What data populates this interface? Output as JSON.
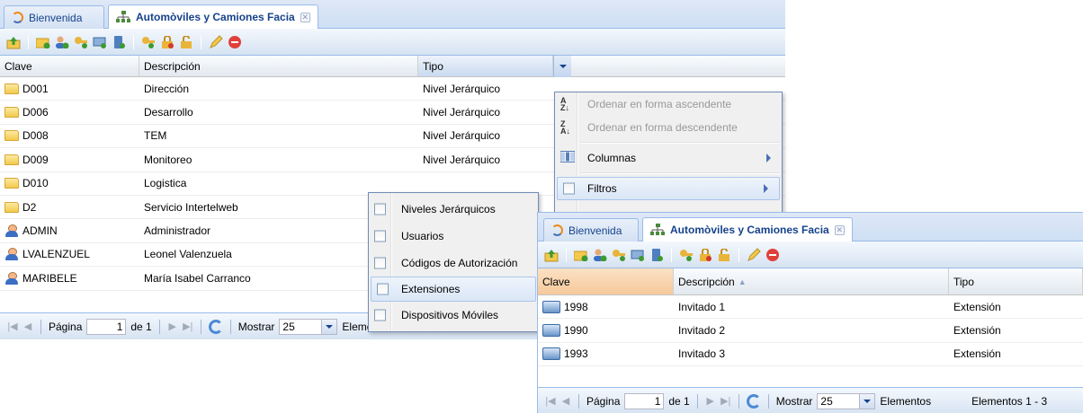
{
  "colors": {
    "header_blue": "#15428b",
    "panel_border": "#99bbe8",
    "sorted_header": "#f6c99c"
  },
  "main": {
    "tabs": [
      {
        "label": "Bienvenida",
        "icon": "swirl-icon"
      },
      {
        "label": "Automòviles y Camiones Facia",
        "icon": "org-chart-icon",
        "closable": true
      }
    ],
    "columns": [
      "Clave",
      "Descripción",
      "Tipo"
    ],
    "rows": [
      {
        "icon": "folder-icon",
        "clave": "D001",
        "descripcion": "Dirección",
        "tipo": "Nivel Jerárquico"
      },
      {
        "icon": "folder-icon",
        "clave": "D006",
        "descripcion": "Desarrollo",
        "tipo": "Nivel Jerárquico"
      },
      {
        "icon": "folder-icon",
        "clave": "D008",
        "descripcion": "TEM",
        "tipo": "Nivel Jerárquico"
      },
      {
        "icon": "folder-icon",
        "clave": "D009",
        "descripcion": "Monitoreo",
        "tipo": "Nivel Jerárquico"
      },
      {
        "icon": "folder-icon",
        "clave": "D010",
        "descripcion": "Logistica",
        "tipo": ""
      },
      {
        "icon": "folder-icon",
        "clave": "D2",
        "descripcion": "Servicio Intertelweb",
        "tipo": ""
      },
      {
        "icon": "user-icon",
        "clave": "ADMIN",
        "descripcion": "Administrador",
        "tipo": ""
      },
      {
        "icon": "user-icon",
        "clave": "LVALENZUEL",
        "descripcion": "Leonel Valenzuela",
        "tipo": ""
      },
      {
        "icon": "user-icon",
        "clave": "MARIBELE",
        "descripcion": "María Isabel Carranco",
        "tipo": ""
      }
    ],
    "pager": {
      "page_label": "Página",
      "page_value": "1",
      "of_label": "de 1",
      "show_label": "Mostrar",
      "show_value": "25",
      "elements_label": "Elementos"
    }
  },
  "column_menu": {
    "items": [
      {
        "label": "Ordenar en forma ascendente",
        "icon": "sort-asc-icon",
        "disabled": true
      },
      {
        "label": "Ordenar en forma descendente",
        "icon": "sort-desc-icon",
        "disabled": true
      },
      {
        "label": "Columnas",
        "icon": "columns-icon",
        "submenu": true
      },
      {
        "label": "Filtros",
        "icon": "checkbox",
        "submenu": true,
        "hover": true
      }
    ]
  },
  "filter_menu": {
    "items": [
      {
        "label": "Niveles Jerárquicos",
        "checked": false
      },
      {
        "label": "Usuarios",
        "checked": false
      },
      {
        "label": "Códigos de Autorización",
        "checked": false
      },
      {
        "label": "Extensiones",
        "checked": false,
        "hover": true
      },
      {
        "label": "Dispositivos Móviles",
        "checked": false
      }
    ]
  },
  "second": {
    "tabs": [
      {
        "label": "Bienvenida"
      },
      {
        "label": "Automòviles y Camiones Facia"
      }
    ],
    "columns": [
      "Clave",
      "Descripción",
      "Tipo"
    ],
    "sort_indicator": "▲",
    "rows": [
      {
        "icon": "phone-icon",
        "clave": "1998",
        "descripcion": "Invitado 1",
        "tipo": "Extensión"
      },
      {
        "icon": "phone-icon",
        "clave": "1990",
        "descripcion": "Invitado 2",
        "tipo": "Extensión"
      },
      {
        "icon": "phone-icon",
        "clave": "1993",
        "descripcion": "Invitado 3",
        "tipo": "Extensión"
      }
    ],
    "pager": {
      "page_label": "Página",
      "page_value": "1",
      "of_label": "de 1",
      "show_label": "Mostrar",
      "show_value": "25",
      "elements_label": "Elementos",
      "count_label": "Elementos 1 - 3"
    }
  }
}
